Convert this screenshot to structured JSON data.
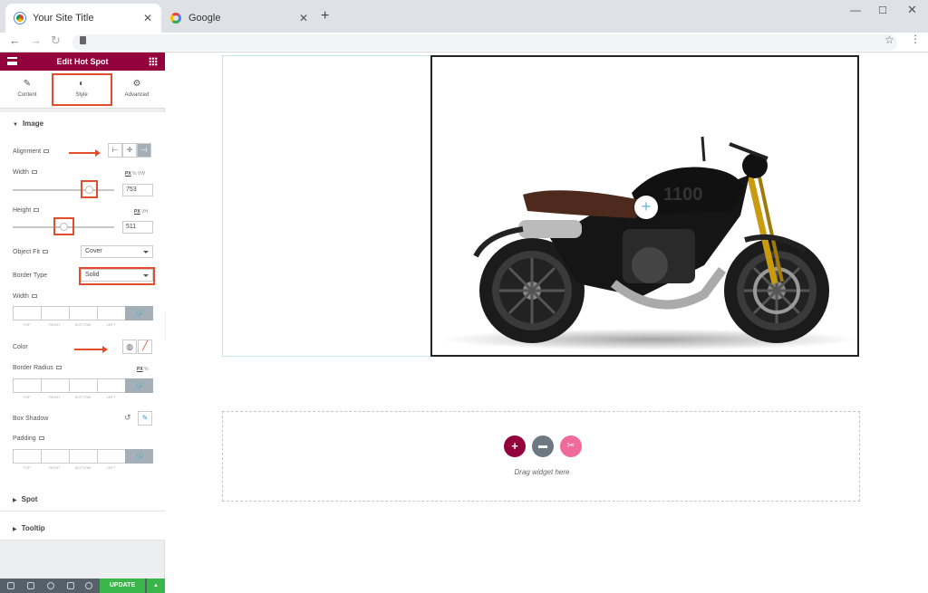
{
  "browser": {
    "tabs": [
      {
        "title": "Your Site Title",
        "active": true
      },
      {
        "title": "Google",
        "active": false
      }
    ]
  },
  "panel": {
    "title": "Edit Hot Spot",
    "tabs": [
      {
        "label": "Content"
      },
      {
        "label": "Style",
        "active": true
      },
      {
        "label": "Advanced"
      }
    ],
    "sections": {
      "image": "Image",
      "spot": "Spot",
      "tooltip": "Tooltip"
    },
    "fields": {
      "alignment": "Alignment",
      "width": "Width",
      "width_value": "753",
      "width_units": [
        "PX",
        "%",
        "VW"
      ],
      "width_slider_fraction": 0.76,
      "height": "Height",
      "height_value": "511",
      "height_units": [
        "PX",
        "VH"
      ],
      "height_slider_fraction": 0.51,
      "object_fit": "Object Fit",
      "object_fit_value": "Cover",
      "border_type": "Border Type",
      "border_type_value": "Solid",
      "border_width": "Width",
      "color": "Color",
      "border_radius": "Border Radius",
      "radius_units": [
        "PX",
        "%"
      ],
      "box_shadow": "Box Shadow",
      "padding": "Padding",
      "dim_labels": [
        "TOP",
        "RIGHT",
        "BOTTOM",
        "LEFT"
      ]
    },
    "footer": {
      "update": "UPDATE"
    }
  },
  "canvas": {
    "drop_text": "Drag widget here"
  },
  "colors": {
    "brand": "#93003c",
    "annotation": "#e24d2c",
    "update": "#39b54a"
  }
}
